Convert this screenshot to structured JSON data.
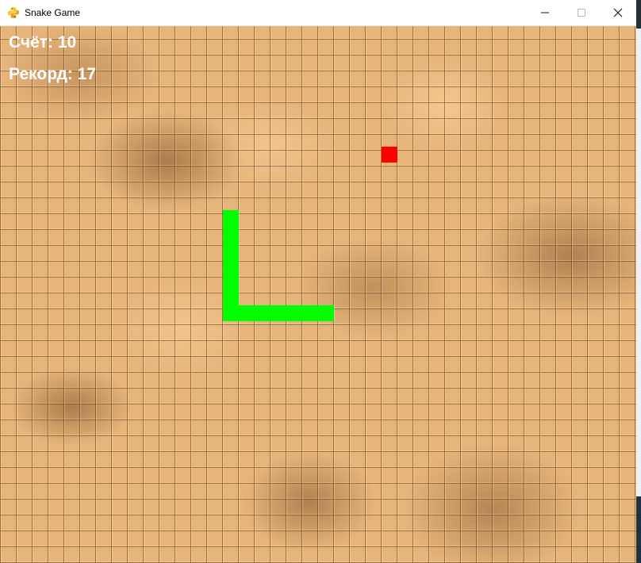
{
  "window": {
    "title": "Snake Game",
    "minimize_glyph": "—",
    "maximize_glyph": "☐",
    "close_glyph": "✕"
  },
  "hud": {
    "score": "Счёт: 10",
    "record": "Рекорд: 17"
  },
  "colors": {
    "snake": "#00ff00",
    "food": "#ff0000",
    "hud_text": "#ffffff",
    "tile_base": "#e7b57a"
  },
  "game": {
    "grid_cell": 20,
    "snake": [
      [
        14,
        13
      ],
      [
        14,
        14
      ],
      [
        14,
        15
      ],
      [
        14,
        16
      ],
      [
        14,
        17
      ],
      [
        14,
        18
      ],
      [
        14,
        19
      ],
      [
        15,
        19
      ],
      [
        16,
        19
      ],
      [
        17,
        19
      ],
      [
        18,
        19
      ],
      [
        19,
        19
      ],
      [
        20,
        19
      ]
    ],
    "food": [
      24,
      9
    ]
  },
  "icons": {
    "app": "python-icon"
  }
}
